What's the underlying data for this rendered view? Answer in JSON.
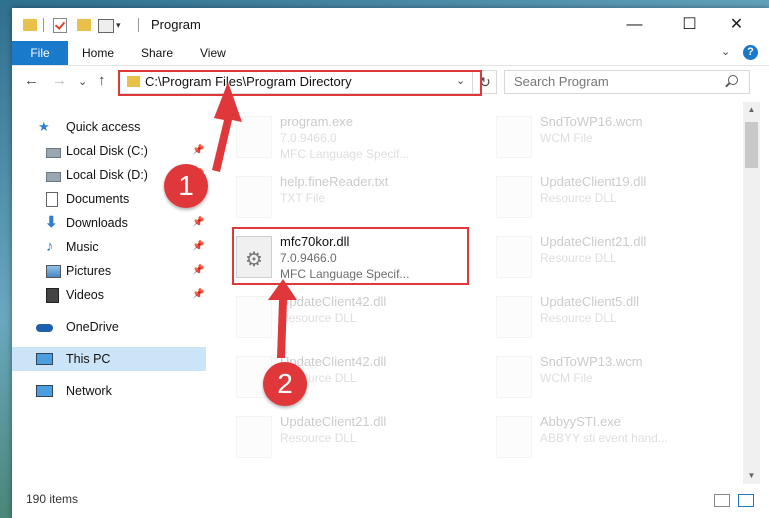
{
  "window": {
    "title": "Program",
    "minimize_glyph": "—",
    "maximize_glyph": "☐",
    "close_glyph": "✕"
  },
  "ribbon": {
    "tabs": [
      "File",
      "Home",
      "Share",
      "View"
    ],
    "expand_glyph": "⌄",
    "help_glyph": "?"
  },
  "nav": {
    "back_glyph": "←",
    "forward_glyph": "→",
    "recent_glyph": "⌄",
    "up_glyph": "↑",
    "address": "C:\\Program Files\\Program Directory",
    "address_dropdown_glyph": "⌄",
    "refresh_glyph": "↻",
    "search_placeholder": "Search Program"
  },
  "sidebar": {
    "items": [
      {
        "label": "Quick access",
        "icon": "star-icon",
        "pinned": false
      },
      {
        "label": "Local Disk (C:)",
        "icon": "drive-icon",
        "pinned": true
      },
      {
        "label": "Local Disk (D:)",
        "icon": "drive-icon",
        "pinned": true
      },
      {
        "label": "Documents",
        "icon": "document-icon",
        "pinned": true
      },
      {
        "label": "Downloads",
        "icon": "download-icon",
        "pinned": true
      },
      {
        "label": "Music",
        "icon": "music-icon",
        "pinned": true
      },
      {
        "label": "Pictures",
        "icon": "picture-icon",
        "pinned": true
      },
      {
        "label": "Videos",
        "icon": "video-icon",
        "pinned": true
      },
      {
        "label": "OneDrive",
        "icon": "cloud-icon",
        "pinned": false
      },
      {
        "label": "This PC",
        "icon": "computer-icon",
        "pinned": false,
        "selected": true
      },
      {
        "label": "Network",
        "icon": "network-icon",
        "pinned": false
      }
    ],
    "pin_glyph": "📌"
  },
  "files": {
    "left": [
      {
        "name": "program.exe",
        "line2": "7.0.9466.0",
        "line3": "MFC Language Specif...",
        "faded": true
      },
      {
        "name": "help.fineReader.txt",
        "line2": "TXT File",
        "line3": "",
        "faded": true
      },
      {
        "name": "mfc70kor.dll",
        "line2": "7.0.9466.0",
        "line3": "MFC Language Specif...",
        "faded": false
      },
      {
        "name": "UpdateClient42.dll",
        "line2": "Resource DLL",
        "line3": "",
        "faded": true
      },
      {
        "name": "UpdateClient42.dll",
        "line2": "Resource DLL",
        "line3": "",
        "faded": true
      },
      {
        "name": "UpdateClient21.dll",
        "line2": "Resource DLL",
        "line3": "",
        "faded": true
      }
    ],
    "right": [
      {
        "name": "SndToWP16.wcm",
        "line2": "WCM File",
        "line3": "",
        "faded": true
      },
      {
        "name": "UpdateClient19.dll",
        "line2": "Resource DLL",
        "line3": "",
        "faded": true
      },
      {
        "name": "UpdateClient21.dll",
        "line2": "Resource DLL",
        "line3": "",
        "faded": true
      },
      {
        "name": "UpdateClient5.dll",
        "line2": "Resource DLL",
        "line3": "",
        "faded": true
      },
      {
        "name": "SndToWP13.wcm",
        "line2": "WCM File",
        "line3": "",
        "faded": true
      },
      {
        "name": "AbbyySTI.exe",
        "line2": "ABBYY sti event hand...",
        "line3": "",
        "faded": true
      }
    ]
  },
  "status": {
    "item_count": "190 items"
  },
  "annotations": {
    "marker1": "1",
    "marker2": "2",
    "color": "#e0383a"
  }
}
